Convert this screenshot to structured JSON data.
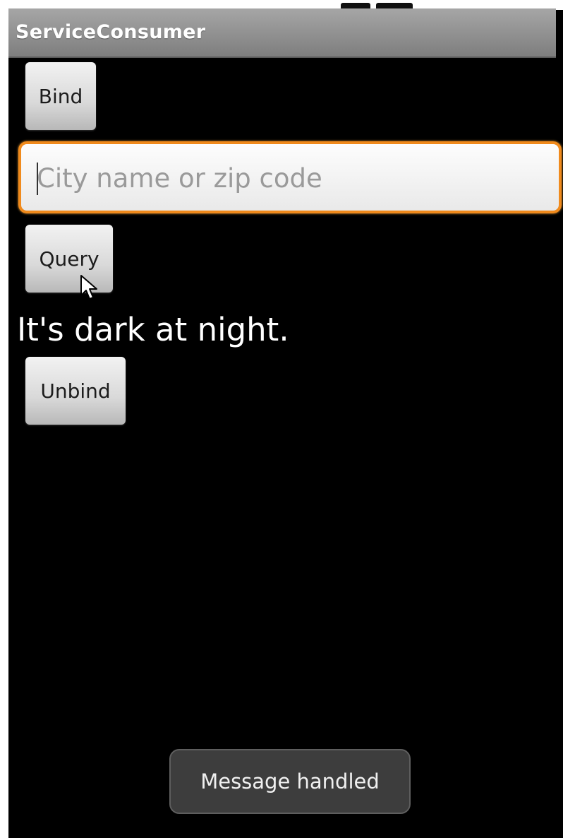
{
  "app": {
    "title": "ServiceConsumer"
  },
  "buttons": {
    "bind_label": "Bind",
    "query_label": "Query",
    "unbind_label": "Unbind"
  },
  "query_input": {
    "value": "",
    "placeholder": "City name or zip code"
  },
  "result": {
    "text": "It's dark at night."
  },
  "toast": {
    "message": "Message handled"
  },
  "colors": {
    "focus_border": "#f08a1c",
    "titlebar": "#8e8e8e",
    "background": "#000000"
  },
  "icons": {
    "pointer": "mouse-pointer-icon"
  }
}
